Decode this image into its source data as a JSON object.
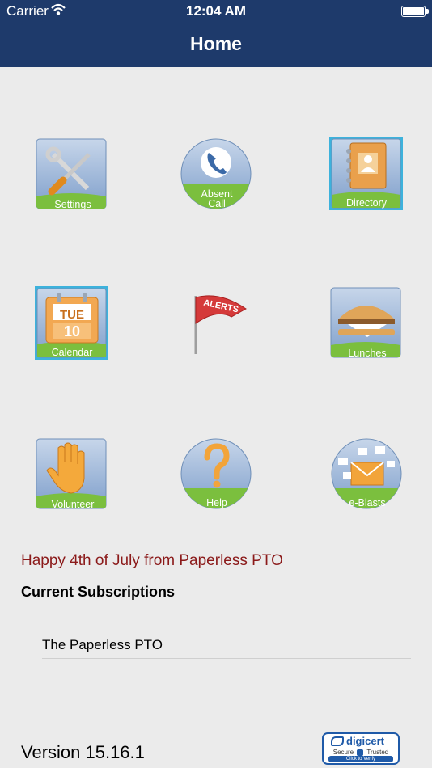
{
  "status_bar": {
    "carrier": "Carrier",
    "time": "12:04 AM"
  },
  "nav": {
    "title": "Home"
  },
  "tiles": {
    "settings": "Settings",
    "absent_call_1": "Absent",
    "absent_call_2": "Call",
    "directory": "Directory",
    "calendar": "Calendar",
    "calendar_day": "TUE",
    "calendar_date": "10",
    "alerts": "ALERTS",
    "lunches": "Lunches",
    "volunteer": "Volunteer",
    "help": "Help",
    "eblasts": "e-Blasts"
  },
  "message": "Happy 4th of July from Paperless PTO",
  "subscriptions": {
    "title": "Current Subscriptions",
    "items": [
      "The Paperless PTO"
    ]
  },
  "footer": {
    "version": "Version 15.16.1",
    "seal_brand": "digicert",
    "seal_secure": "Secure",
    "seal_trusted": "Trusted",
    "seal_verify": "Click to Verify"
  },
  "colors": {
    "nav_bg": "#1e3a6b",
    "page_bg": "#ebebeb",
    "tile_green": "#7bbf3e",
    "message": "#8b1a1a"
  }
}
